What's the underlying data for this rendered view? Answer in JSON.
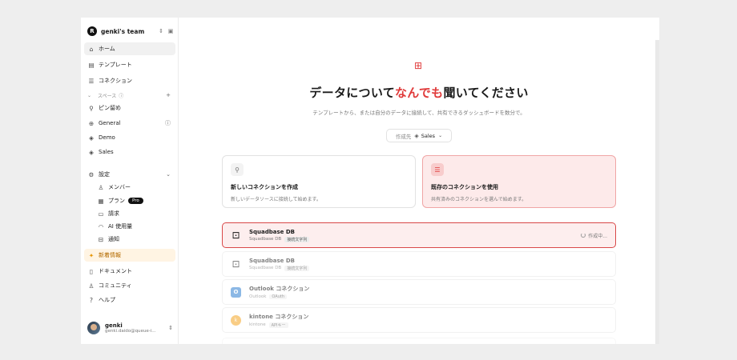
{
  "sidebar": {
    "team_initial": "R",
    "team_name": "genki's team",
    "team_switch_icon": "updown-icon",
    "collapse_icon": "sidebar-toggle-icon",
    "nav": [
      {
        "label": "ホーム",
        "icon": "home-icon"
      },
      {
        "label": "テンプレート",
        "icon": "template-icon"
      },
      {
        "label": "コネクション",
        "icon": "database-icon"
      }
    ],
    "spaces_label": "スペース",
    "spaces": [
      {
        "label": "ピン留め",
        "icon": "pin-icon"
      },
      {
        "label": "General",
        "icon": "globe-icon"
      },
      {
        "label": "Demo",
        "icon": "cube-icon"
      },
      {
        "label": "Sales",
        "icon": "cube-icon"
      }
    ],
    "settings_label": "設定",
    "settings": [
      {
        "label": "メンバー",
        "icon": "user-icon"
      },
      {
        "label": "プラン",
        "icon": "calendar-icon",
        "badge": "Pro"
      },
      {
        "label": "請求",
        "icon": "billing-icon"
      },
      {
        "label": "AI 使用量",
        "icon": "gauge-icon"
      },
      {
        "label": "通知",
        "icon": "inbox-icon"
      }
    ],
    "news_label": "新着情報",
    "bottom": [
      {
        "label": "ドキュメント",
        "icon": "doc-icon"
      },
      {
        "label": "コミュニティ",
        "icon": "users-icon"
      },
      {
        "label": "ヘルプ",
        "icon": "help-icon"
      }
    ],
    "user": {
      "name": "genki",
      "email": "genki.daido@queue-i..."
    }
  },
  "main": {
    "headline_prefix": "データについて",
    "headline_accent": "なんでも",
    "headline_suffix": "聞いてください",
    "subline": "テンプレートから、または自分のデータに接続して、共有できるダッシュボードを数分で。",
    "target_label": "作成先",
    "target_value": "Sales",
    "cards": [
      {
        "title": "新しいコネクションを作成",
        "desc": "新しいデータソースに接続して始めます。",
        "icon": "plug-icon"
      },
      {
        "title": "既存のコネクションを使用",
        "desc": "共有済みのコネクションを選んで始めます。",
        "icon": "database-icon"
      }
    ],
    "connections": [
      {
        "name": "Squadbase DB",
        "type": "Squadbase DB",
        "tag": "接続文字列",
        "status": "作成中..."
      },
      {
        "name": "Squadbase DB",
        "type": "Squadbase DB",
        "tag": "接続文字列"
      },
      {
        "name": "Outlook コネクション",
        "type": "Outlook",
        "tag": "OAuth"
      },
      {
        "name": "kintone コネクション",
        "type": "kintone",
        "tag": "APIキー"
      }
    ]
  },
  "colors": {
    "accent": "#e03b3b",
    "news": "#e69500"
  }
}
